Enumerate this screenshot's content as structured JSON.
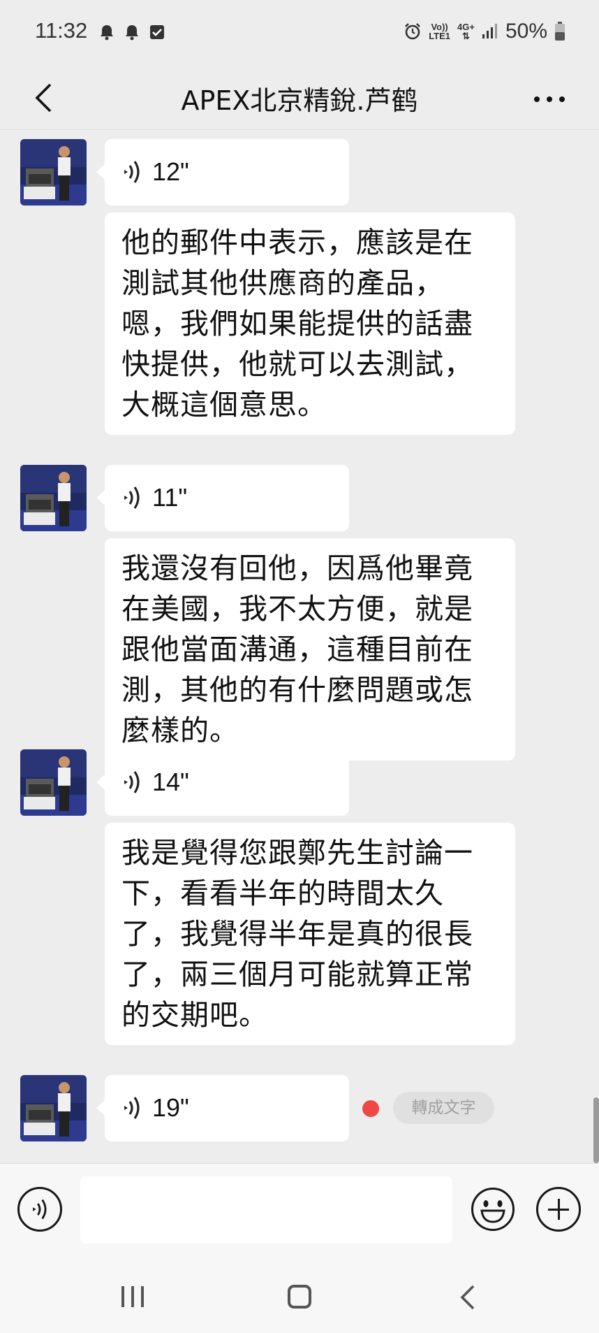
{
  "status_bar": {
    "time": "11:32",
    "notification_icons": [
      "bell-icon",
      "bell-icon",
      "checkbox-icon"
    ],
    "alarm_icon": "alarm-icon",
    "network_volte": "Vo))",
    "network_lte": "LTE1",
    "network_4g": "4G+",
    "signal_icon": "signal-icon",
    "battery_text": "50%"
  },
  "header": {
    "back_icon": "chevron-left-icon",
    "title": "APEX北京精銳.芦鹤",
    "more_icon": "more-dots-icon"
  },
  "messages": [
    {
      "type": "voice",
      "duration": "12\""
    },
    {
      "type": "text",
      "text": "他的郵件中表示，應該是在測試其他供應商的產品，嗯，我們如果能提供的話盡快提供，他就可以去測試，大概這個意思。"
    },
    {
      "type": "voice",
      "duration": "11\""
    },
    {
      "type": "text",
      "text": "我還沒有回他，因爲他畢竟在美國，我不太方便，就是跟他當面溝通，這種目前在測，其他的有什麼問題或怎麼樣的。"
    },
    {
      "type": "voice",
      "duration": "14\""
    },
    {
      "type": "text",
      "text": "我是覺得您跟鄭先生討論一下，看看半年的時間太久了，我覺得半年是真的很長了，兩三個月可能就算正常的交期吧。"
    },
    {
      "type": "voice",
      "duration": "19\"",
      "unread": true,
      "transcribe_label": "轉成文字"
    }
  ],
  "input_bar": {
    "voice_toggle_icon": "voice-input-icon",
    "input_value": "",
    "emoji_icon": "emoji-icon",
    "plus_icon": "plus-icon"
  },
  "nav_bar": {
    "recents_icon": "recents-icon",
    "home_icon": "home-icon",
    "back_icon": "back-icon"
  },
  "colors": {
    "background": "#ededed",
    "bubble": "#ffffff",
    "unread_dot": "#f04646",
    "transcribe_bg": "#e0e0e0"
  }
}
